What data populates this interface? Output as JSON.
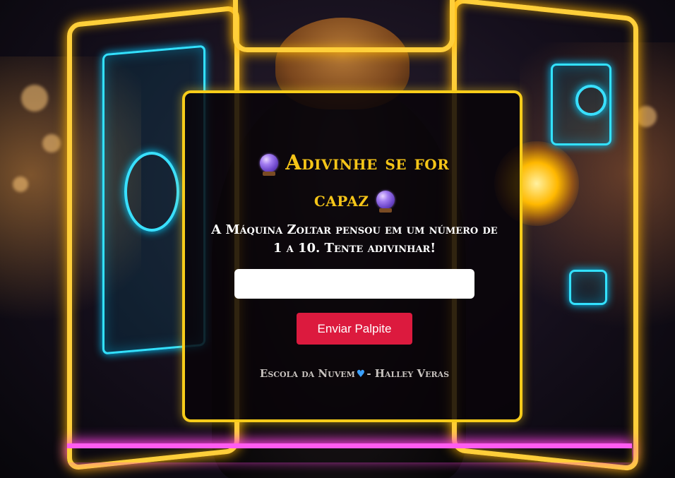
{
  "game": {
    "title_part1": "Adivinhe se for",
    "title_part2": "capaz",
    "title_icon": "crystal-ball-icon",
    "subtitle": "A Máquina Zoltar pensou em um número de 1 a 10. Tente adivinhar!",
    "input_value": "",
    "input_placeholder": "",
    "submit_label": "Enviar Palpite"
  },
  "footer": {
    "school": "Escola da Nuvem",
    "heart_icon": "blue-heart-icon",
    "author": "- Halley Veras"
  },
  "colors": {
    "accent_gold": "#f5c518",
    "button_red": "#dc1a3e",
    "card_border": "#f7cc1a",
    "heart_blue": "#3aa0ff"
  }
}
